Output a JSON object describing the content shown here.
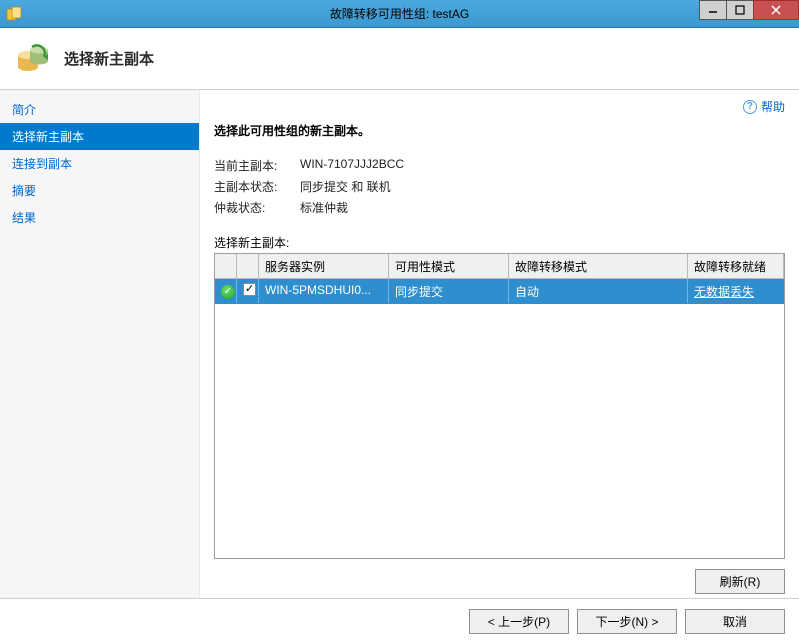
{
  "window": {
    "title": "故障转移可用性组: testAG"
  },
  "header": {
    "title": "选择新主副本"
  },
  "sidebar": {
    "items": [
      {
        "label": "简介"
      },
      {
        "label": "选择新主副本"
      },
      {
        "label": "连接到副本"
      },
      {
        "label": "摘要"
      },
      {
        "label": "结果"
      }
    ],
    "current_index": 1
  },
  "help": {
    "label": "帮助"
  },
  "main": {
    "instruction": "选择此可用性组的新主副本。",
    "current_primary_label": "当前主副本:",
    "current_primary_value": "WIN-7107JJJ2BCC",
    "primary_state_label": "主副本状态:",
    "primary_state_value": "同步提交 和 联机",
    "quorum_label": "仲裁状态:",
    "quorum_value": "标准仲裁",
    "select_table_label": "选择新主副本:",
    "columns": {
      "server": "服务器实例",
      "mode": "可用性模式",
      "failover": "故障转移模式",
      "readiness": "故障转移就绪"
    },
    "rows": [
      {
        "status": "ok",
        "checked": true,
        "server": "WIN-5PMSDHUI0...",
        "mode": "同步提交",
        "failover": "自动",
        "readiness": "无数据丢失"
      }
    ],
    "refresh_label": "刷新(R)"
  },
  "footer": {
    "prev": "< 上一步(P)",
    "next": "下一步(N) >",
    "cancel": "取消"
  }
}
